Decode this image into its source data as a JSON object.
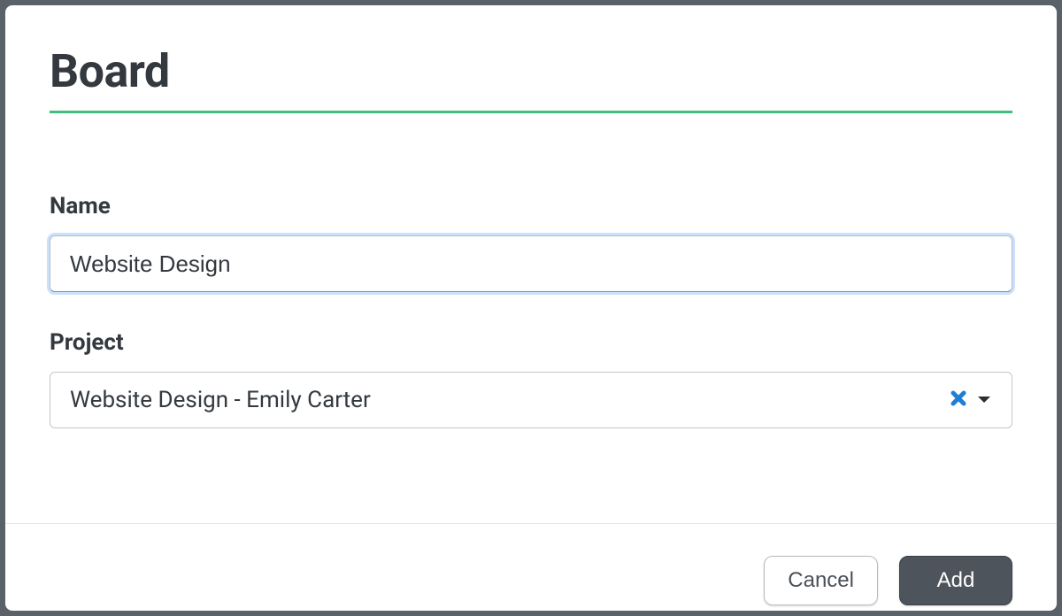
{
  "modal": {
    "title": "Board"
  },
  "form": {
    "name": {
      "label": "Name",
      "value": "Website Design"
    },
    "project": {
      "label": "Project",
      "selected": "Website Design - Emily Carter"
    }
  },
  "actions": {
    "cancel": "Cancel",
    "add": "Add"
  },
  "colors": {
    "accent_underline": "#3fbf7f",
    "clear_icon": "#1e7fd6",
    "primary_button_bg": "#4e545c"
  }
}
